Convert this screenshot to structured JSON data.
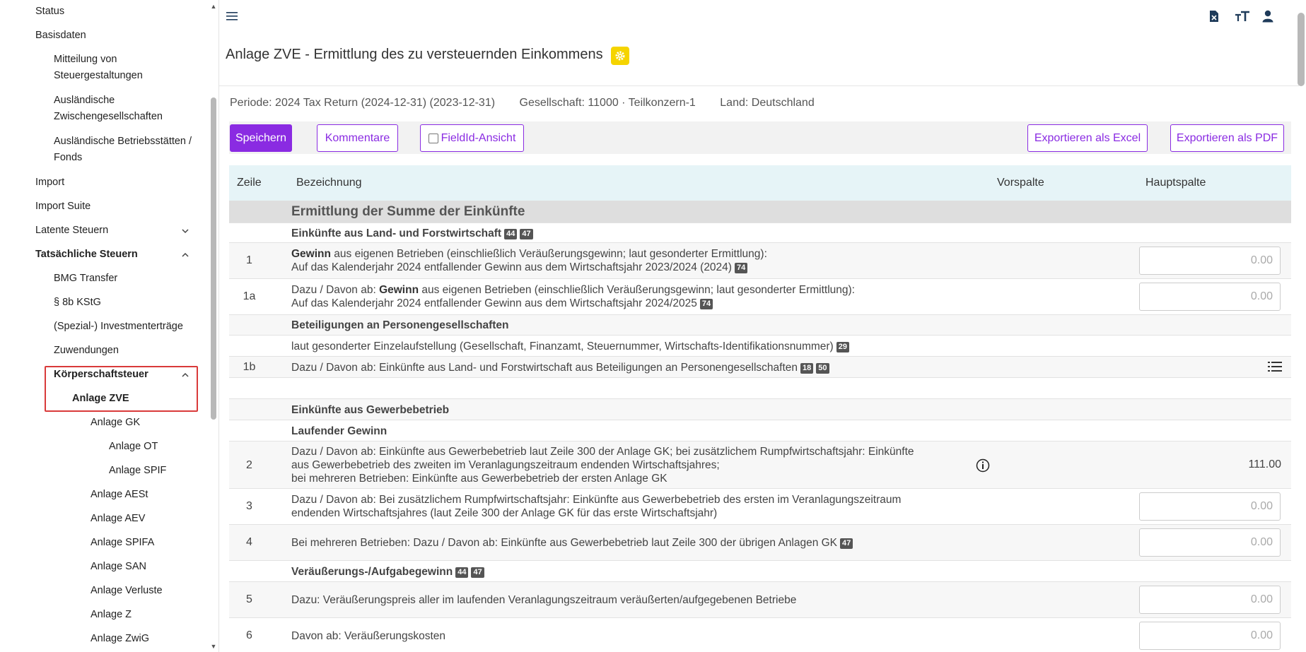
{
  "sidebar": {
    "items": [
      {
        "label": "Status"
      },
      {
        "label": "Basisdaten"
      },
      {
        "label": "Mitteilung von"
      },
      {
        "label": "Steuergestaltungen"
      },
      {
        "label": "Ausländische"
      },
      {
        "label": "Zwischengesellschaften"
      },
      {
        "label": "Ausländische Betriebsstätten /"
      },
      {
        "label": "Fonds"
      },
      {
        "label": "Import"
      },
      {
        "label": "Import Suite"
      },
      {
        "label": "Latente Steuern"
      },
      {
        "label": "Tatsächliche Steuern"
      },
      {
        "label": "BMG Transfer"
      },
      {
        "label": "§ 8b KStG"
      },
      {
        "label": "(Spezial-) Investmenterträge"
      },
      {
        "label": "Zuwendungen"
      },
      {
        "label": "Körperschaftsteuer"
      },
      {
        "label": "Anlage ZVE"
      },
      {
        "label": "Anlage GK"
      },
      {
        "label": "Anlage OT"
      },
      {
        "label": "Anlage SPIF"
      },
      {
        "label": "Anlage AESt"
      },
      {
        "label": "Anlage AEV"
      },
      {
        "label": "Anlage SPIFA"
      },
      {
        "label": "Anlage SAN"
      },
      {
        "label": "Anlage Verluste"
      },
      {
        "label": "Anlage Z"
      },
      {
        "label": "Anlage ZwiG"
      }
    ]
  },
  "header": {
    "title": "Anlage ZVE - Ermittlung des zu versteuernden Einkommens",
    "icons": [
      "menu-icon",
      "excel-file-icon",
      "font-size-icon",
      "user-icon"
    ]
  },
  "info": {
    "periode": "Periode: 2024 Tax Return (2024-12-31) (2023-12-31)",
    "gesellschaft": "Gesellschaft: 11000 · Teilkonzern-1",
    "land": "Land: Deutschland"
  },
  "toolbar": {
    "save": "Speichern",
    "comments": "Kommentare",
    "fieldid": "FieldId-Ansicht",
    "export_excel": "Exportieren als Excel",
    "export_pdf": "Exportieren als PDF"
  },
  "table": {
    "headers": {
      "zeile": "Zeile",
      "bezeichnung": "Bezeichnung",
      "vorspalte": "Vorspalte",
      "hauptspalte": "Hauptspalte"
    },
    "section1": "Ermittlung der Summe der Einkünfte",
    "lf_title": "Einkünfte aus Land- und Forstwirtschaft",
    "tags_44": "44",
    "tags_47": "47",
    "tags_74": "74",
    "tags_29": "29",
    "tags_18": "18",
    "tags_50": "50",
    "r1_zeile": "1",
    "r1_bold": "Gewinn",
    "r1_line1": " aus eigenen Betrieben (einschließlich Veräußerungsgewinn; laut gesonderter Ermittlung):",
    "r1_line2": "Auf das Kalenderjahr 2024 entfallender Gewinn aus dem Wirtschaftsjahr 2023/2024 (2024)",
    "r1_value": "0.00",
    "r1a_zeile": "1a",
    "r1a_pre": "Dazu / Davon ab: ",
    "r1a_bold": "Gewinn",
    "r1a_line1": " aus eigenen Betrieben (einschließlich Veräußerungsgewinn; laut gesonderter Ermittlung):",
    "r1a_line2": "Auf das Kalenderjahr 2024 entfallender Gewinn aus dem Wirtschaftsjahr 2024/2025",
    "r1a_value": "0.00",
    "beteil_title": "Beteiligungen an Personengesellschaften",
    "beteil_text": "laut gesonderter Einzelaufstellung (Gesellschaft, Finanzamt, Steuernummer, Wirtschafts-Identifikationsnummer)",
    "r1b_zeile": "1b",
    "r1b_text": "Dazu / Davon ab: Einkünfte aus Land- und Forstwirtschaft aus Beteiligungen an Personengesellschaften",
    "gew_title": "Einkünfte aus Gewerbebetrieb",
    "lauf_title": "Laufender Gewinn",
    "r2_zeile": "2",
    "r2_line1": "Dazu / Davon ab: Einkünfte aus Gewerbebetrieb laut Zeile 300 der Anlage GK; bei zusätzlichem Rumpfwirtschaftsjahr: Einkünfte",
    "r2_line2": "aus Gewerbebetrieb des zweiten im Veranlagungszeitraum endenden Wirtschaftsjahres;",
    "r2_line3": "bei mehreren Betrieben: Einkünfte aus Gewerbebetrieb der ersten Anlage GK",
    "r2_value": "111.00",
    "r3_zeile": "3",
    "r3_line1": "Dazu / Davon ab: Bei zusätzlichem Rumpfwirtschaftsjahr: Einkünfte aus Gewerbebetrieb des ersten im Veranlagungszeitraum",
    "r3_line2": "endenden Wirtschaftsjahres (laut Zeile 300 der Anlage GK für das erste Wirtschaftsjahr)",
    "r3_value": "0.00",
    "r4_zeile": "4",
    "r4_text": "Bei mehreren Betrieben: Dazu / Davon ab: Einkünfte aus Gewerbebetrieb laut Zeile 300 der übrigen Anlagen GK",
    "r4_value": "0.00",
    "veraeu_title": "Veräußerungs-/Aufgabegewinn",
    "r5_zeile": "5",
    "r5_text": "Dazu: Veräußerungspreis aller im laufenden Veranlagungszeitraum veräußerten/aufgegebenen Betriebe",
    "r5_value": "0.00",
    "r6_zeile": "6",
    "r6_text": "Davon ab: Veräußerungskosten",
    "r6_value": "0.00"
  },
  "colors": {
    "accent": "#8a2be2",
    "highlight": "#d93a3a",
    "gear_badge": "#f5d400",
    "header_bg": "#e6f4f7"
  }
}
